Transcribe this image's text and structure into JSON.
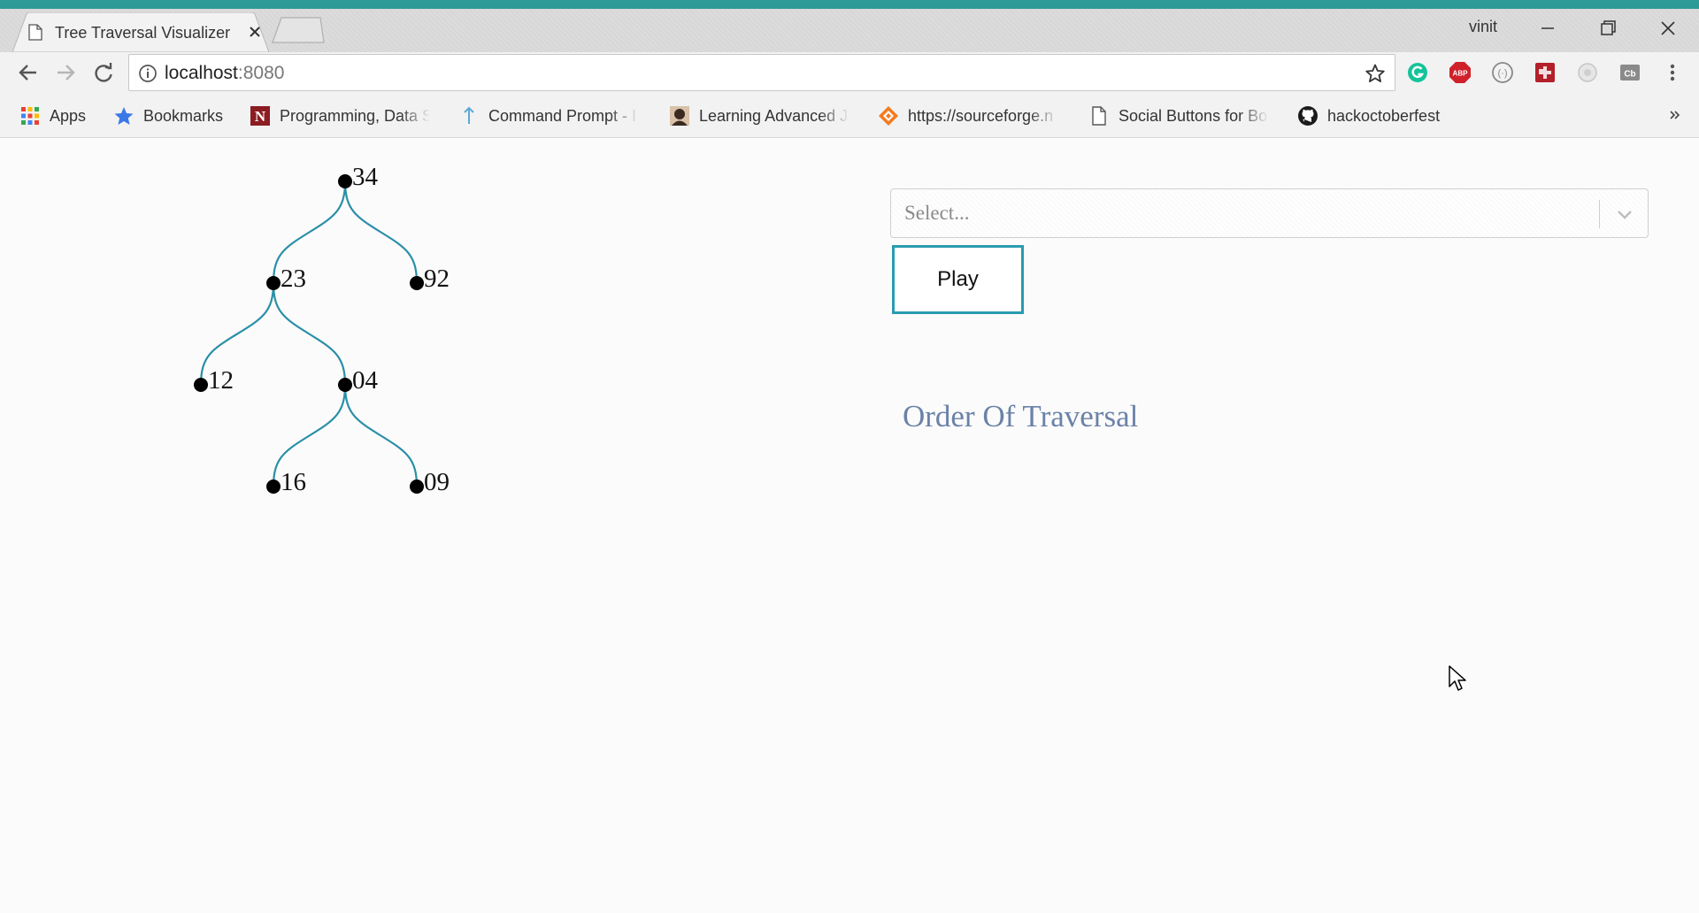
{
  "browser": {
    "tab_title": "Tree Traversal Visualizer",
    "profile_name": "vinit",
    "url_host": "localhost",
    "url_port": ":8080",
    "accent_color": "#2d9a97"
  },
  "bookmarks": [
    {
      "label": "Apps",
      "icon": "apps-grid-icon"
    },
    {
      "label": "Bookmarks",
      "icon": "star-icon"
    },
    {
      "label": "Programming, Data S",
      "icon": "site-favicon"
    },
    {
      "label": "Command Prompt - I",
      "icon": "pin-icon"
    },
    {
      "label": "Learning Advanced J",
      "icon": "avatar-favicon"
    },
    {
      "label": "https://sourceforge.n",
      "icon": "sourceforge-icon"
    },
    {
      "label": "Social Buttons for Bo",
      "icon": "page-icon"
    },
    {
      "label": "hackoctoberfest",
      "icon": "github-icon"
    }
  ],
  "tree": {
    "edge_color": "#2a8fa8",
    "node_color": "#000000",
    "nodes": [
      {
        "id": "n34",
        "label": "34"
      },
      {
        "id": "n23",
        "label": "23"
      },
      {
        "id": "n92",
        "label": "92"
      },
      {
        "id": "n12",
        "label": "12"
      },
      {
        "id": "n04",
        "label": "04"
      },
      {
        "id": "n16",
        "label": "16"
      },
      {
        "id": "n09",
        "label": "09"
      }
    ],
    "edges": [
      [
        "n34",
        "n23"
      ],
      [
        "n34",
        "n92"
      ],
      [
        "n23",
        "n12"
      ],
      [
        "n23",
        "n04"
      ],
      [
        "n04",
        "n16"
      ],
      [
        "n04",
        "n09"
      ]
    ]
  },
  "controls": {
    "select_placeholder": "Select...",
    "play_label": "Play",
    "play_border_color": "#2a9bb0"
  },
  "traversal": {
    "title": "Order Of Traversal",
    "title_color": "#6b82a8"
  }
}
